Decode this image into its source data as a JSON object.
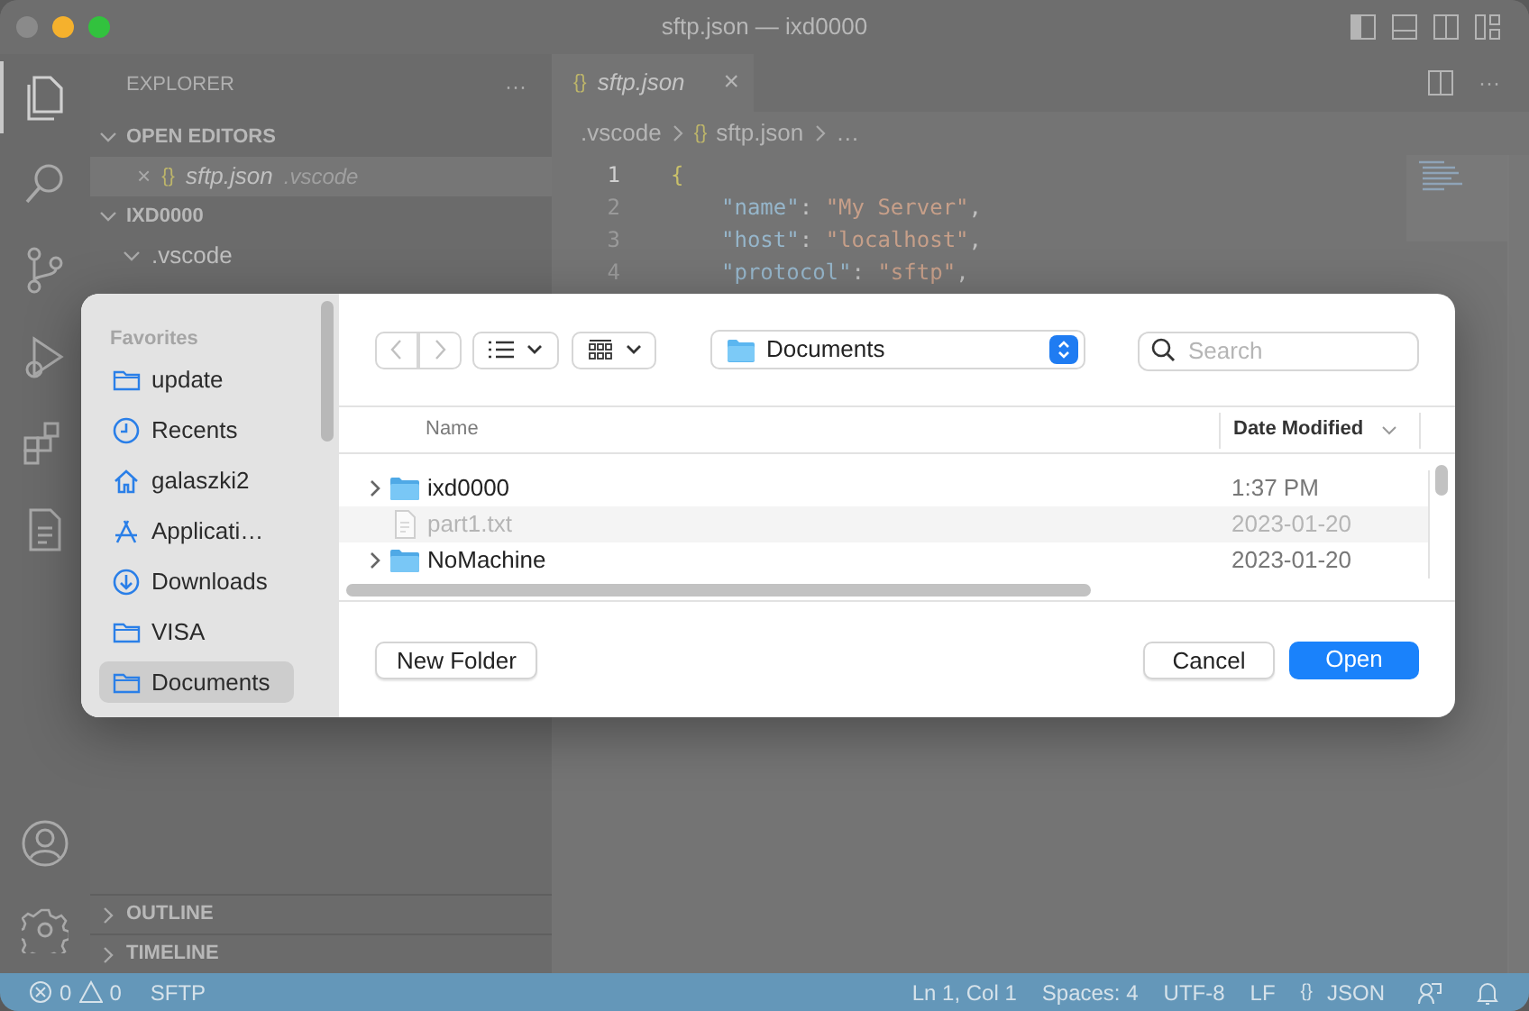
{
  "window": {
    "title": "sftp.json — ixd0000"
  },
  "activity_bar": [
    {
      "kind": "files",
      "selected": true
    },
    {
      "kind": "search",
      "selected": false
    },
    {
      "kind": "source-control",
      "selected": false
    },
    {
      "kind": "run",
      "selected": false
    },
    {
      "kind": "extensions",
      "selected": false
    },
    {
      "kind": "remote",
      "selected": false
    }
  ],
  "explorer": {
    "title": "EXPLORER",
    "more": "···",
    "open_editors": {
      "label": "OPEN EDITORS",
      "expanded": true,
      "items": [
        {
          "close": "×",
          "icon": "{}",
          "name": "sftp.json",
          "folder": ".vscode"
        }
      ]
    },
    "workspace": {
      "label": "IXD0000",
      "expanded": true,
      "children": [
        {
          "name": ".vscode",
          "expanded": true
        }
      ]
    },
    "outline": {
      "label": "OUTLINE",
      "expanded": false
    },
    "timeline": {
      "label": "TIMELINE",
      "expanded": false
    }
  },
  "editor": {
    "tab": {
      "icon": "{}",
      "label": "sftp.json",
      "close": "×"
    },
    "more": "···",
    "breadcrumb": [
      ".vscode",
      "sftp.json",
      "…"
    ],
    "lines": [
      {
        "number": "1",
        "current": true,
        "tokens": [
          {
            "kind": "brace",
            "text": "{"
          }
        ]
      },
      {
        "number": "2",
        "current": false,
        "tokens": [
          {
            "kind": "key",
            "text": "\"name\""
          },
          {
            "kind": "punct",
            "text": ": "
          },
          {
            "kind": "string",
            "text": "\"My Server\""
          },
          {
            "kind": "punct",
            "text": ","
          }
        ]
      },
      {
        "number": "3",
        "current": false,
        "tokens": [
          {
            "kind": "key",
            "text": "\"host\""
          },
          {
            "kind": "punct",
            "text": ": "
          },
          {
            "kind": "string",
            "text": "\"localhost\""
          },
          {
            "kind": "punct",
            "text": ","
          }
        ]
      },
      {
        "number": "4",
        "current": false,
        "tokens": [
          {
            "kind": "key",
            "text": "\"protocol\""
          },
          {
            "kind": "punct",
            "text": ": "
          },
          {
            "kind": "string",
            "text": "\"sftp\""
          },
          {
            "kind": "punct",
            "text": ","
          }
        ]
      }
    ]
  },
  "dialog": {
    "sidebar": {
      "section": "Favorites",
      "items": [
        {
          "label": "update",
          "kind": "folder",
          "selected": false
        },
        {
          "label": "Recents",
          "kind": "clock",
          "selected": false
        },
        {
          "label": "galaszki2",
          "kind": "home",
          "selected": false
        },
        {
          "label": "Applicati…",
          "kind": "apps",
          "selected": false
        },
        {
          "label": "Downloads",
          "kind": "download",
          "selected": false
        },
        {
          "label": "VISA",
          "kind": "folder",
          "selected": false
        },
        {
          "label": "Documents",
          "kind": "folder",
          "selected": true
        }
      ]
    },
    "location": "Documents",
    "search": {
      "placeholder": "Search"
    },
    "columns": [
      "Name",
      "Date Modified"
    ],
    "files": [
      {
        "name": "ixd0000",
        "date": "1:37 PM",
        "kind": "folder",
        "disabled": false
      },
      {
        "name": "part1.txt",
        "date": "2023-01-20",
        "kind": "file",
        "disabled": true
      },
      {
        "name": "NoMachine",
        "date": "2023-01-20",
        "kind": "folder",
        "disabled": false
      }
    ],
    "buttons": [
      {
        "label": "New Folder",
        "kind": "secondary"
      },
      {
        "label": "Cancel",
        "kind": "secondary"
      },
      {
        "label": "Open",
        "kind": "primary"
      }
    ]
  },
  "status_bar": {
    "errors": "0",
    "warnings": "0",
    "left": [
      "SFTP"
    ],
    "right": [
      "Ln 1, Col 1",
      "Spaces: 4",
      "UTF-8",
      "LF"
    ],
    "language": {
      "icon": "{}",
      "label": "JSON"
    }
  }
}
